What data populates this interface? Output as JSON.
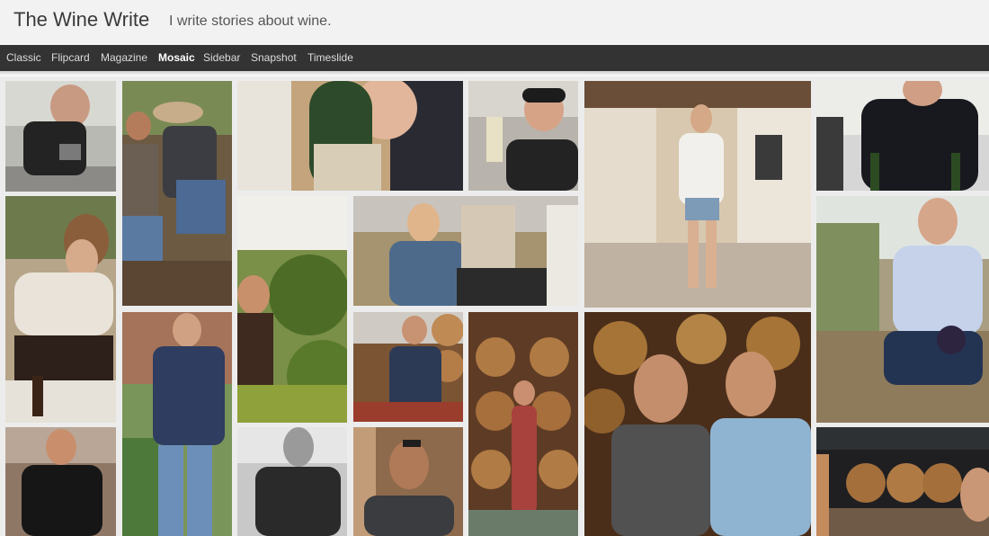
{
  "site": {
    "title": "The Wine Write",
    "description": "I write stories about wine."
  },
  "nav": {
    "items": [
      "Classic",
      "Flipcard",
      "Magazine",
      "Mosaic",
      "Sidebar",
      "Snapshot",
      "Timeslide"
    ],
    "active": "Mosaic"
  },
  "colors": {
    "header_bg": "#f2f2f2",
    "nav_bg": "#333333",
    "nav_active": "#ffffff",
    "nav_text": "#dcdcdc"
  }
}
